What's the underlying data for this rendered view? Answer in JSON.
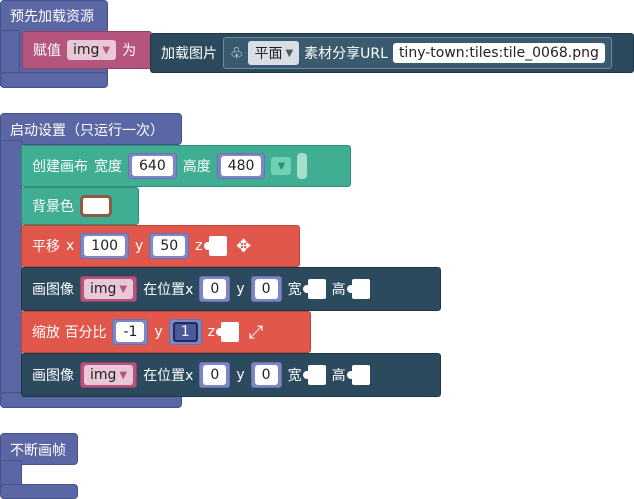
{
  "preload": {
    "hat_label": "预先加载资源",
    "assign_label": "赋值",
    "var_name": "img",
    "as_label": "为",
    "load_image_label": "加载图片",
    "tile_mode": "平面",
    "material_label": "素材分享URL",
    "url_value": "tiny-town:tiles:tile_0068.png"
  },
  "setup": {
    "hat_label": "启动设置（只运行一次）",
    "create_canvas_label": "创建画布",
    "width_label": "宽度",
    "width_value": "640",
    "height_label": "高度",
    "height_value": "480",
    "background_label": "背景色",
    "translate_label": "平移",
    "x_label": "x",
    "translate_x": "100",
    "y_label": "y",
    "translate_y": "50",
    "z_label": "z",
    "draw_image_label": "画图像",
    "img_var": "img",
    "at_position_label": "在位置x",
    "pos_x": "0",
    "pos_y": "0",
    "w_label": "宽",
    "h_label": "高",
    "scale_label": "缩放 百分比",
    "scale_x": "-1",
    "scale_y": "1"
  },
  "loop": {
    "hat_label": "不断画帧"
  },
  "colors": {
    "hat": "#5b67a5",
    "teal": "#3fae92",
    "red": "#e2574b",
    "navy": "#2c4a5e",
    "magenta": "#b5557f"
  }
}
